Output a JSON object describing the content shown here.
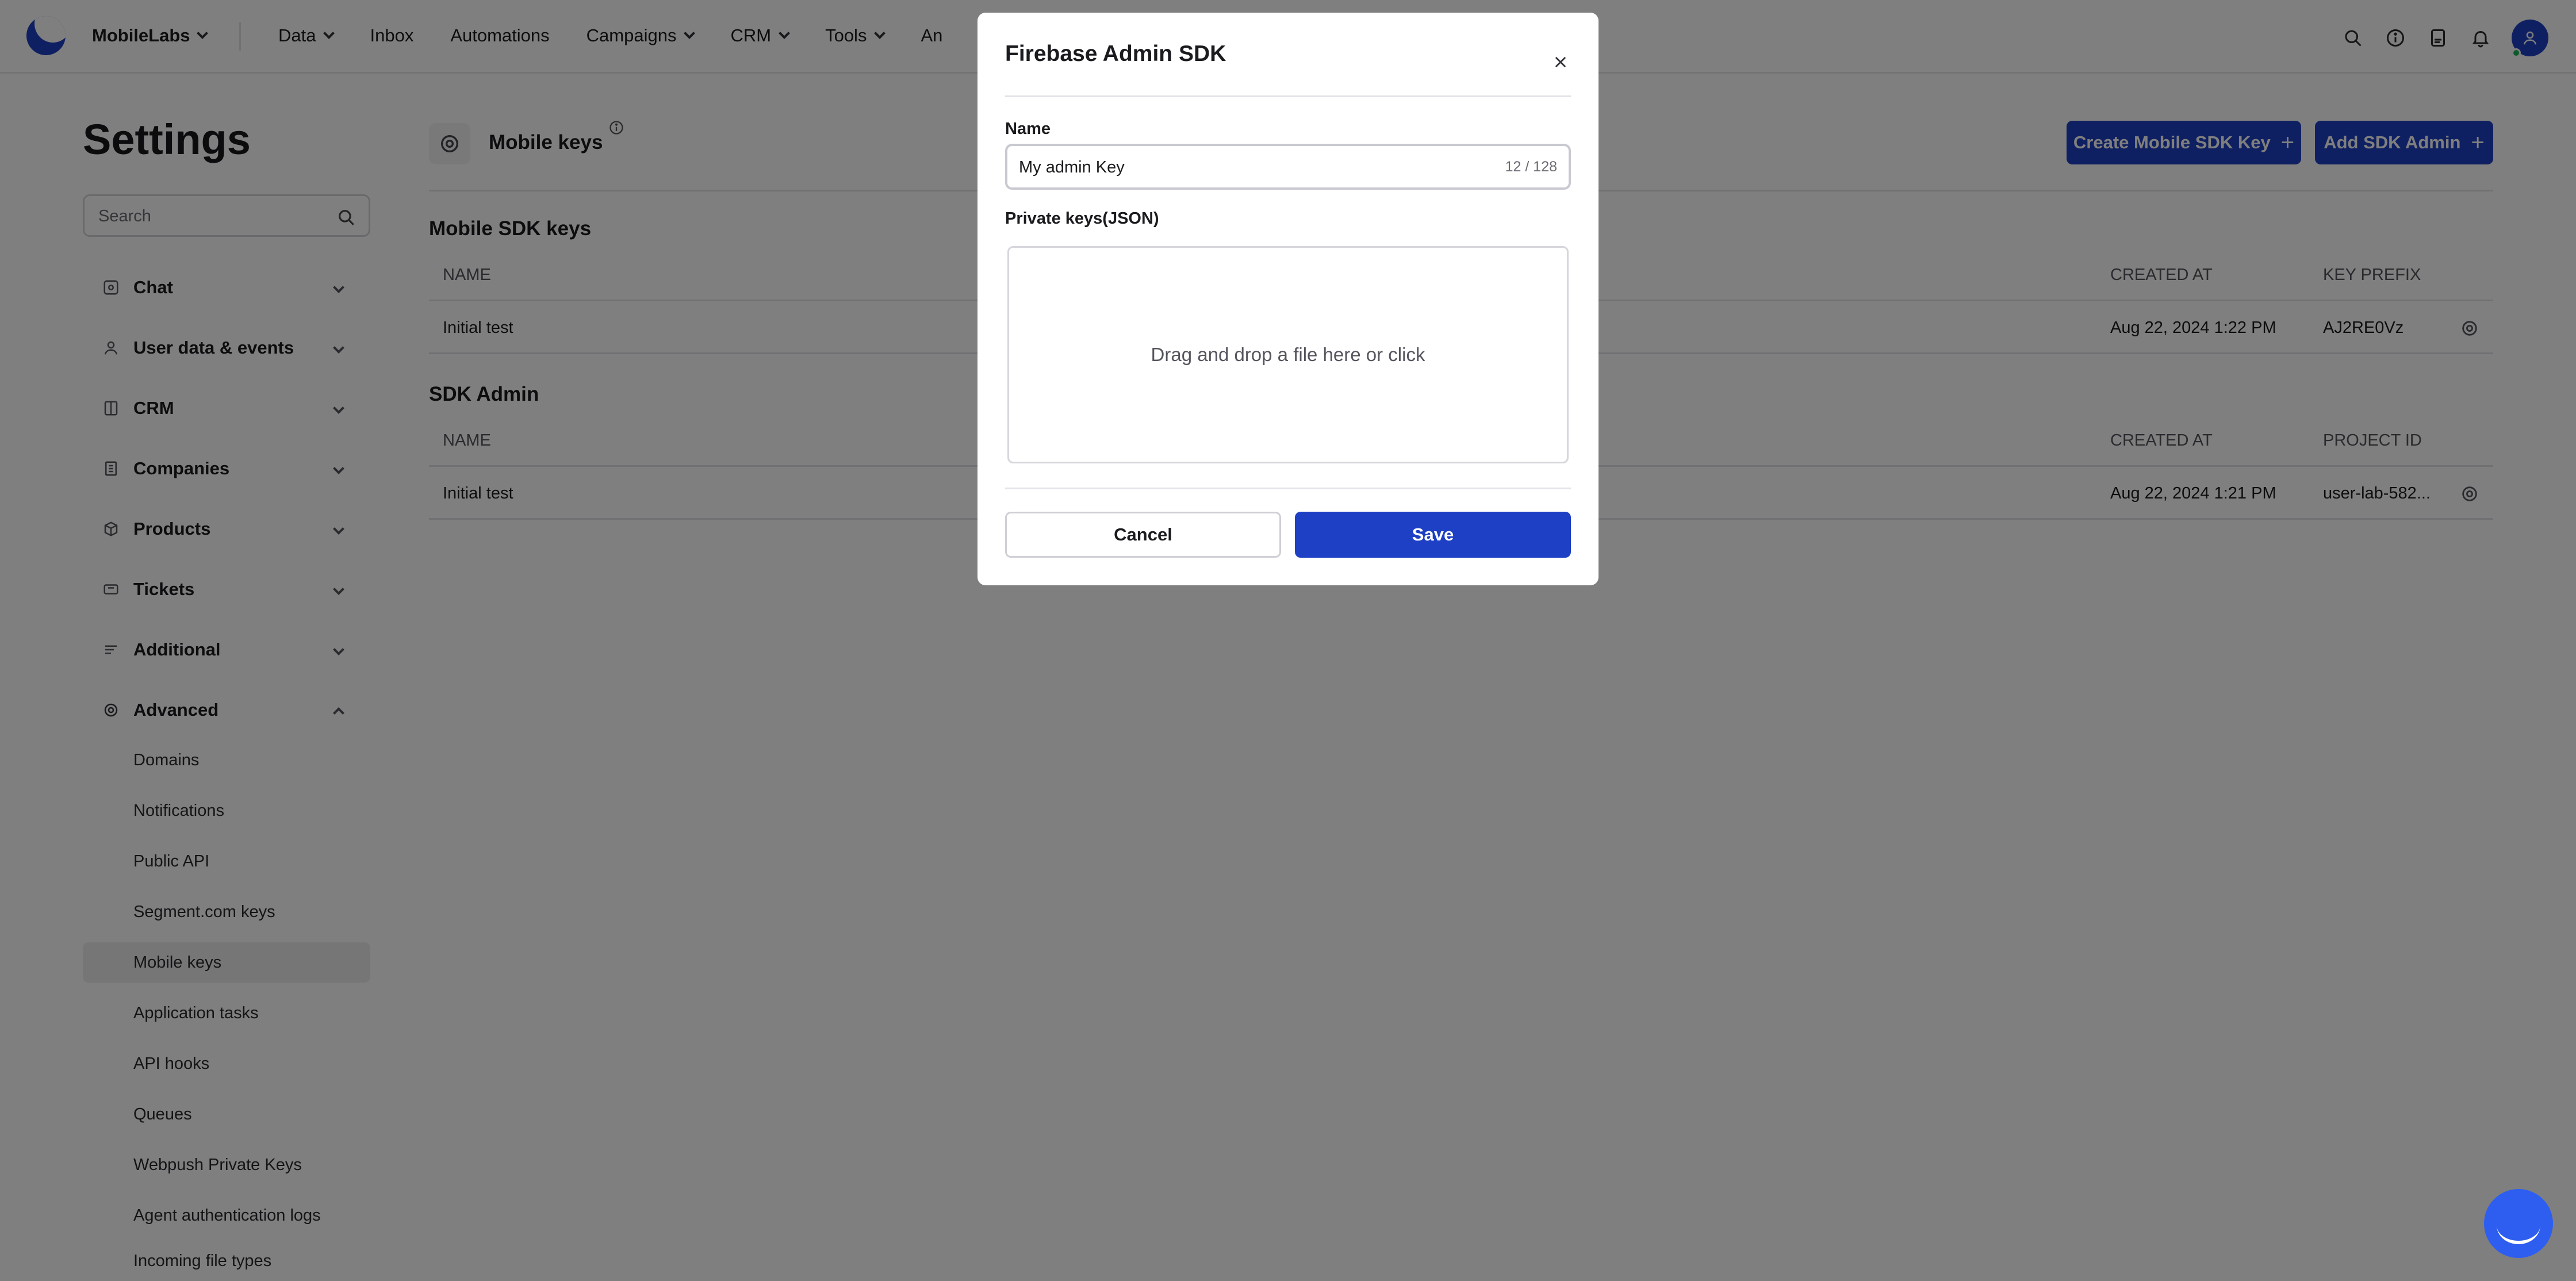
{
  "topbar": {
    "brand": "MobileLabs",
    "nav": [
      {
        "label": "Data",
        "has_dropdown": true
      },
      {
        "label": "Inbox",
        "has_dropdown": false
      },
      {
        "label": "Automations",
        "has_dropdown": false
      },
      {
        "label": "Campaigns",
        "has_dropdown": true
      },
      {
        "label": "CRM",
        "has_dropdown": true
      },
      {
        "label": "Tools",
        "has_dropdown": true
      },
      {
        "label": "An",
        "has_dropdown": false
      }
    ],
    "icons": [
      "search-icon",
      "info-icon",
      "docs-icon",
      "bell-icon",
      "user-avatar"
    ]
  },
  "sidebar": {
    "title": "Settings",
    "search_placeholder": "Search",
    "groups": [
      {
        "label": "Chat",
        "icon": "chat-icon",
        "expanded": false
      },
      {
        "label": "User data & events",
        "icon": "user-icon",
        "expanded": false
      },
      {
        "label": "CRM",
        "icon": "crm-icon",
        "expanded": false
      },
      {
        "label": "Companies",
        "icon": "building-icon",
        "expanded": false
      },
      {
        "label": "Products",
        "icon": "box-icon",
        "expanded": false
      },
      {
        "label": "Tickets",
        "icon": "ticket-icon",
        "expanded": false
      },
      {
        "label": "Additional",
        "icon": "list-icon",
        "expanded": false
      },
      {
        "label": "Advanced",
        "icon": "gear-icon",
        "expanded": true
      }
    ],
    "advanced_items": [
      {
        "label": "Domains",
        "active": false
      },
      {
        "label": "Notifications",
        "active": false
      },
      {
        "label": "Public API",
        "active": false
      },
      {
        "label": "Segment.com keys",
        "active": false
      },
      {
        "label": "Mobile keys",
        "active": true
      },
      {
        "label": "Application tasks",
        "active": false
      },
      {
        "label": "API hooks",
        "active": false
      },
      {
        "label": "Queues",
        "active": false
      },
      {
        "label": "Webpush Private Keys",
        "active": false
      },
      {
        "label": "Agent authentication logs",
        "active": false
      },
      {
        "label": "Incoming file types",
        "active": false
      }
    ]
  },
  "main": {
    "title": "Mobile keys",
    "buttons": {
      "create_mobile_sdk_key": "Create Mobile SDK Key",
      "add_sdk_admin": "Add SDK Admin"
    },
    "mobile_sdk_keys": {
      "title": "Mobile SDK keys",
      "columns": [
        "NAME",
        "CREATED AT",
        "KEY PREFIX"
      ],
      "rows": [
        {
          "name": "Initial test",
          "created_at": "Aug 22, 2024 1:22 PM",
          "key_prefix": "AJ2RE0Vz"
        }
      ]
    },
    "sdk_admin": {
      "title": "SDK Admin",
      "columns": [
        "NAME",
        "CREATED AT",
        "PROJECT ID"
      ],
      "rows": [
        {
          "name": "Initial test",
          "created_at": "Aug 22, 2024 1:21 PM",
          "project_id": "user-lab-582..."
        }
      ]
    }
  },
  "modal": {
    "title": "Firebase Admin SDK",
    "name_label": "Name",
    "name_value": "My admin Key",
    "name_counter": "12 / 128",
    "private_keys_label": "Private keys(JSON)",
    "dropzone_text": "Drag and drop a file here or click",
    "cancel_label": "Cancel",
    "save_label": "Save"
  },
  "colors": {
    "brand": "#1e40c4",
    "overlay": "rgba(0,0,0,0.5)",
    "chat_fab": "#2e5ef0"
  }
}
